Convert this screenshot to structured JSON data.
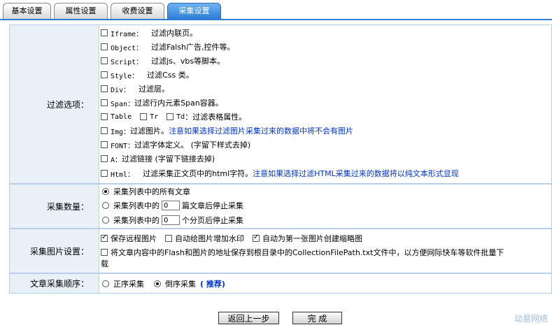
{
  "tabs": [
    "基本设置",
    "属性设置",
    "收费设置",
    "采集设置"
  ],
  "filter": {
    "label": "过滤选项：",
    "items": [
      {
        "tag": "Iframe：",
        "desc": "过滤内联页。"
      },
      {
        "tag": "Object：",
        "desc": "过滤Falsh广告,控件等。"
      },
      {
        "tag": "Script：",
        "desc": "过滤js、vbs等脚本。"
      },
      {
        "tag": "Style：",
        "desc": "过滤Css 类。"
      },
      {
        "tag": "Div：",
        "desc": "过滤层。"
      },
      {
        "tag": "Span：",
        "desc": "过滤行内元素Span容器。"
      },
      {
        "tag": "Img：",
        "desc": "过滤图片。",
        "note": "注意如果选择过滤图片采集过来的数据中将不会有图片"
      },
      {
        "tag": "FONT：",
        "desc": "过滤字体定义。 (字留下样式去掉)"
      },
      {
        "tag": "A：",
        "desc": "过滤链接 (字留下链接去掉)"
      },
      {
        "tag": "Html：",
        "desc": "过滤采集正文页中的html字符。",
        "note": "注意如果选择过滤HTML采集过来的数据将以纯文本形式显现"
      }
    ],
    "table_row": {
      "table": "Table",
      "tr": "Tr",
      "td": "Td",
      "desc": "：过滤表格属性。"
    }
  },
  "count": {
    "label": "采集数量：",
    "all": "采集列表中的所有文章",
    "articles_prefix": "采集列表中的",
    "articles_value": "0",
    "articles_suffix": "篇文章后停止采集",
    "pages_prefix": "采集列表中的",
    "pages_value": "0",
    "pages_suffix": "个分页后停止采集"
  },
  "image": {
    "label": "采集图片设置：",
    "save_remote": "保存远程图片",
    "watermark": "自动给图片增加水印",
    "thumbnail": "自动为第一张图片创建缩略图",
    "flash_line1": "将文章内容中的Flash和图片的地址保存到根目录中的CollectionFilePath.txt文件中，以方便网际快车等软件批量下",
    "flash_line2": "载"
  },
  "order": {
    "label": "文章采集顺序：",
    "forward": "正序采集",
    "reverse": "倒序采集",
    "recommend": "( 推荐)"
  },
  "buttons": {
    "back": "返回上一步",
    "finish": "完  成"
  },
  "watermark_text": "动易网络"
}
